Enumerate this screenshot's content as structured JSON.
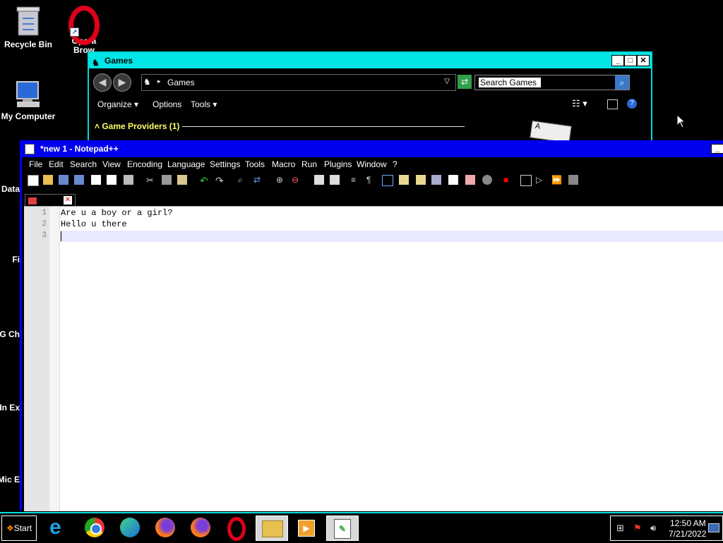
{
  "desktop": {
    "icons": [
      {
        "label": "Recycle Bin"
      },
      {
        "label": "Opera Brow"
      },
      {
        "label": "My Computer"
      },
      {
        "label": "Data"
      },
      {
        "label": "Fi"
      },
      {
        "label": "G Ch"
      },
      {
        "label": "In Ex"
      },
      {
        "label": "Mic E"
      }
    ]
  },
  "games_window": {
    "title": "Games",
    "address": "Games",
    "search_placeholder": "Search Games",
    "toolbar": [
      "Organize",
      "Options",
      "Tools"
    ],
    "group_header": "Game Providers (1)"
  },
  "notepad": {
    "title": "*new 1 - Notepad++",
    "menu": [
      "File",
      "Edit",
      "Search",
      "View",
      "Encoding",
      "Language",
      "Settings",
      "Tools",
      "Macro",
      "Run",
      "Plugins",
      "Window",
      "?"
    ],
    "lines": [
      "Are u a boy or a girl?",
      "Hello u there",
      ""
    ],
    "line_numbers": [
      "1",
      "2",
      "3"
    ]
  },
  "taskbar": {
    "start_label": "Start",
    "time": "12:50 AM",
    "date": "7/21/2022",
    "apps": [
      "internet-explorer",
      "chrome",
      "edge",
      "firefox",
      "firefox",
      "opera",
      "file-explorer",
      "media-player",
      "notepad-plus-plus"
    ]
  },
  "colors": {
    "accent_cyan": "#00e5e5",
    "notepad_title": "#0000ee",
    "games_header": "#ffff66"
  }
}
